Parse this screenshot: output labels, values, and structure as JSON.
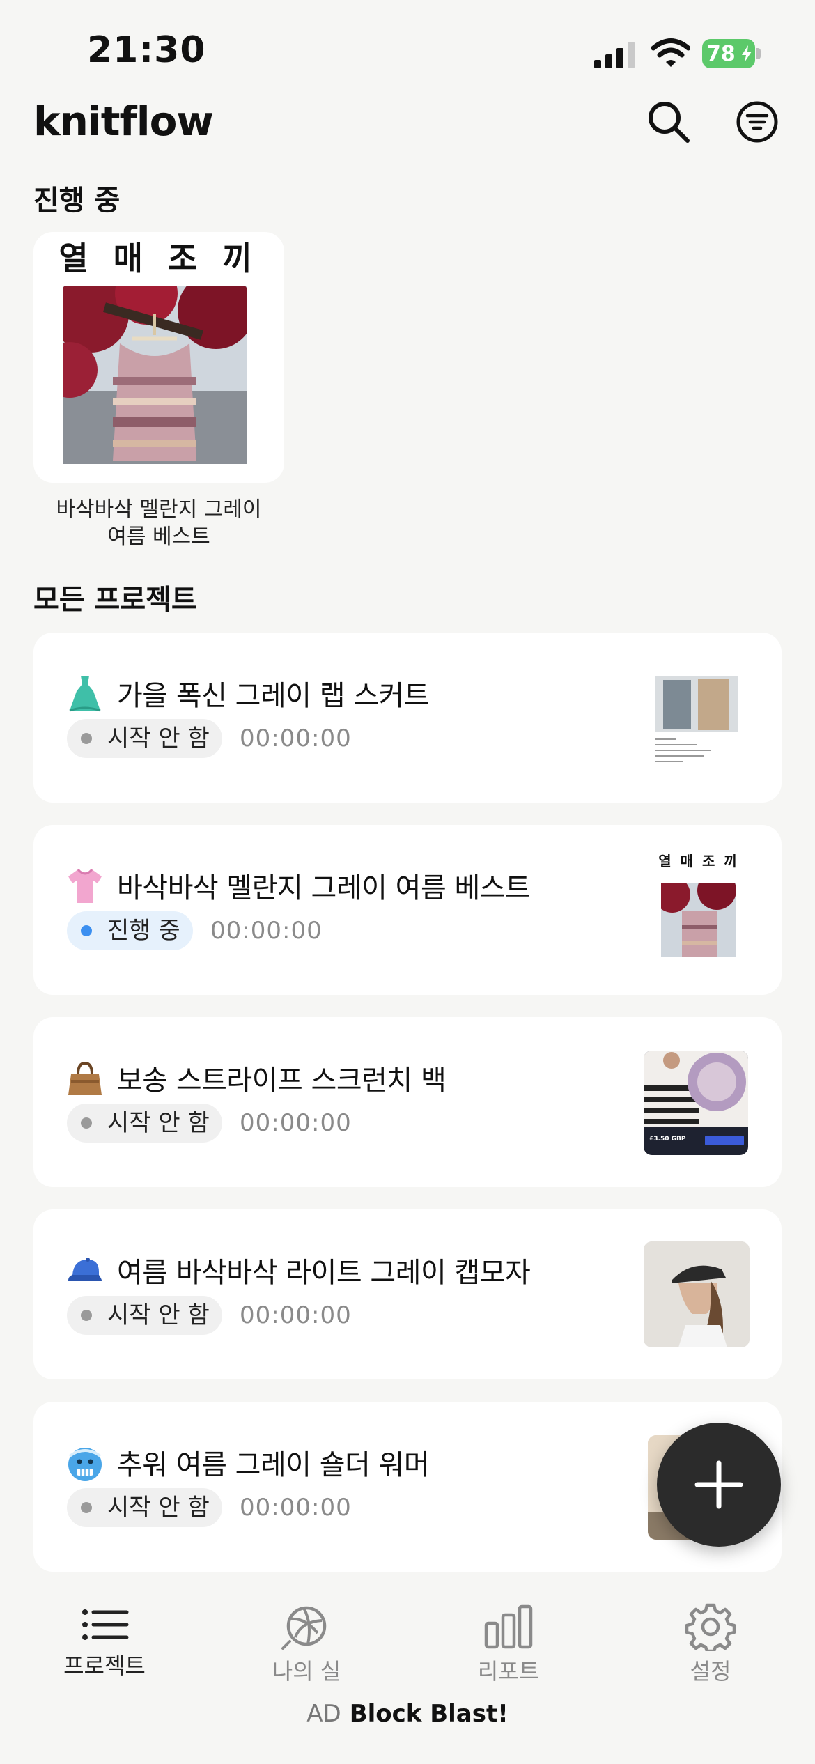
{
  "status_bar": {
    "time": "21:30",
    "battery": "78"
  },
  "header": {
    "title": "knitflow",
    "search_icon": "search-icon",
    "filter_icon": "filter-icon"
  },
  "in_progress": {
    "section_title": "진행 중",
    "card": {
      "image_title": "열 매 조 끼",
      "caption_line1": "바삭바삭 멜란지 그레이",
      "caption_line2": "여름 베스트"
    }
  },
  "all_projects": {
    "section_title": "모든 프로젝트",
    "items": [
      {
        "emoji": "dress-icon",
        "title": "가을 폭신 그레이 랩 스커트",
        "status": "시작 안 함",
        "status_color": "#9a9a9a",
        "timer": "00:00:00"
      },
      {
        "emoji": "tshirt-icon",
        "title": "바삭바삭 멜란지 그레이 여름 베스트",
        "status": "진행 중",
        "status_color": "#3b8ff0",
        "timer": "00:00:00",
        "thumb_title": "열 매 조 끼"
      },
      {
        "emoji": "handbag-icon",
        "title": "보송 스트라이프 스크런치 백",
        "status": "시작 안 함",
        "status_color": "#9a9a9a",
        "timer": "00:00:00",
        "thumb_price": "£3.50 GBP"
      },
      {
        "emoji": "cap-icon",
        "title": "여름 바삭바삭 라이트 그레이 캡모자",
        "status": "시작 안 함",
        "status_color": "#9a9a9a",
        "timer": "00:00:00"
      },
      {
        "emoji": "cold-face-icon",
        "title": "추워 여름 그레이 숄더 워머",
        "status": "시작 안 함",
        "status_color": "#9a9a9a",
        "timer": "00:00:00"
      }
    ]
  },
  "fab": {
    "icon": "plus-icon"
  },
  "tabs": [
    {
      "label": "프로젝트",
      "icon": "list-icon",
      "active": true
    },
    {
      "label": "나의 실",
      "icon": "yarn-icon",
      "active": false
    },
    {
      "label": "리포트",
      "icon": "bar-chart-icon",
      "active": false
    },
    {
      "label": "설정",
      "icon": "gear-icon",
      "active": false
    }
  ],
  "ad": {
    "tag": "AD",
    "name": "Block Blast!"
  },
  "colors": {
    "background": "#f6f6f4",
    "card": "#ffffff",
    "fab": "#2b2b2b",
    "battery": "#5cc96a",
    "active_dot": "#3b8ff0"
  }
}
